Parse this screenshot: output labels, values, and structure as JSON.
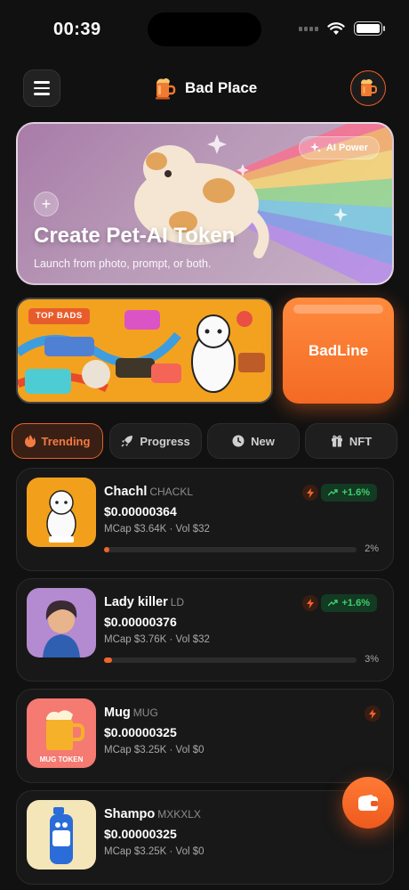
{
  "status_bar": {
    "time": "00:39"
  },
  "header": {
    "app_name": "Bad Place"
  },
  "hero": {
    "badge": "AI Power",
    "title": "Create Pet-AI Token",
    "subtitle": "Launch from photo, prompt, or both."
  },
  "promo": {
    "top_bads_tag": "TOP BADS",
    "badline_label": "BadLine"
  },
  "tabs": [
    {
      "label": "Trending",
      "icon": "flame-icon",
      "active": true
    },
    {
      "label": "Progress",
      "icon": "rocket-icon",
      "active": false
    },
    {
      "label": "New",
      "icon": "clock-icon",
      "active": false
    },
    {
      "label": "NFT",
      "icon": "gift-icon",
      "active": false
    }
  ],
  "tokens": [
    {
      "name": "Chachl",
      "symbol": "CHACKL",
      "price": "$0.00000364",
      "meta": "MCap $3.64K · Vol $32",
      "change": "+1.6%",
      "progress": 2,
      "progress_label": "2%"
    },
    {
      "name": "Lady killer",
      "symbol": "LD",
      "price": "$0.00000376",
      "meta": "MCap $3.76K · Vol $32",
      "change": "+1.6%",
      "progress": 3,
      "progress_label": "3%"
    },
    {
      "name": "Mug",
      "symbol": "MUG",
      "price": "$0.00000325",
      "meta": "MCap $3.25K · Vol $0",
      "image_label": "MUG TOKEN"
    },
    {
      "name": "Shampo",
      "symbol": "MXKXLX",
      "price": "$0.00000325",
      "meta": "MCap $3.25K · Vol $0"
    }
  ],
  "colors": {
    "accent": "#e8612a",
    "positive": "#3ecf6e",
    "background": "#111111"
  }
}
